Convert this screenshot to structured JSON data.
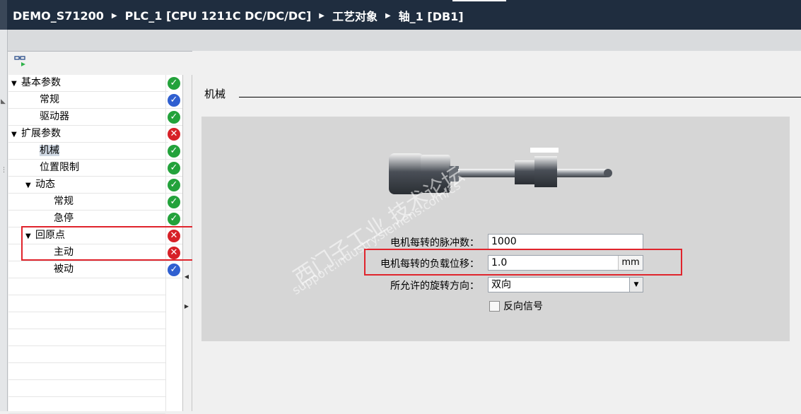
{
  "window": {
    "breadcrumb": [
      "DEMO_S71200",
      "PLC_1 [CPU 1211C DC/DC/DC]",
      "工艺对象",
      "轴_1 [DB1]"
    ]
  },
  "tree": {
    "items": [
      {
        "label": "基本参数",
        "status": "ok",
        "expander": "▼"
      },
      {
        "label": "常规",
        "status": "info"
      },
      {
        "label": "驱动器",
        "status": "ok"
      },
      {
        "label": "扩展参数",
        "status": "error",
        "expander": "▼"
      },
      {
        "label": "机械",
        "status": "ok",
        "selected": true
      },
      {
        "label": "位置限制",
        "status": "ok"
      },
      {
        "label": "动态",
        "status": "ok",
        "expander": "▼"
      },
      {
        "label": "常规",
        "status": "ok"
      },
      {
        "label": "急停",
        "status": "ok"
      },
      {
        "label": "回原点",
        "status": "error",
        "expander": "▼"
      },
      {
        "label": "主动",
        "status": "error"
      },
      {
        "label": "被动",
        "status": "info"
      }
    ]
  },
  "section": {
    "title": "机械"
  },
  "form": {
    "pulses_label": "电机每转的脉冲数：",
    "pulses_value": "1000",
    "distance_label": "电机每转的负载位移：",
    "distance_value": "1.0",
    "distance_unit": "mm",
    "direction_label": "所允许的旋转方向：",
    "direction_value": "双向",
    "invert_label": "反向信号"
  },
  "watermark": {
    "line1": "西门子工业 技术论坛",
    "line2": "support.industry.siemens.com/cs"
  },
  "colors": {
    "ok": "#23a23b",
    "error": "#d72027",
    "info": "#2f5fd0",
    "highlight": "#e0242c"
  }
}
